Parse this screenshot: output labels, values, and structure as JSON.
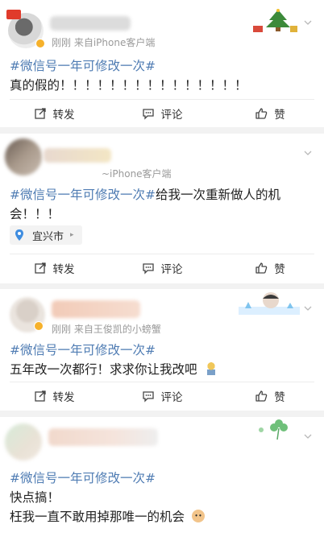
{
  "posts": [
    {
      "meta": "刚刚 来自iPhone客户端",
      "hashtag": "#微信号一年可修改一次#",
      "text": "真的假的！！！！！！！！！！！！！！！",
      "actions": {
        "repost": "转发",
        "comment": "评论",
        "like": "赞"
      }
    },
    {
      "meta": "~iPhone客户端",
      "hashtag": "#微信号一年可修改一次#",
      "text": "给我一次重新做人的机会！！！",
      "location": "宜兴市",
      "actions": {
        "repost": "转发",
        "comment": "评论",
        "like": "赞"
      }
    },
    {
      "meta": "刚刚 来自王俊凯的小螃蟹",
      "hashtag": "#微信号一年可修改一次#",
      "text": "五年改一次都行！求求你让我改吧",
      "actions": {
        "repost": "转发",
        "comment": "评论",
        "like": "赞"
      }
    },
    {
      "hashtag": "#微信号一年可修改一次#",
      "text": "快点搞！",
      "text2": "枉我一直不敢用掉那唯一的机会"
    }
  ],
  "colors": {
    "link": "#4f7cb3",
    "meta": "#9a9a9a",
    "verified": "#f6b12b"
  }
}
